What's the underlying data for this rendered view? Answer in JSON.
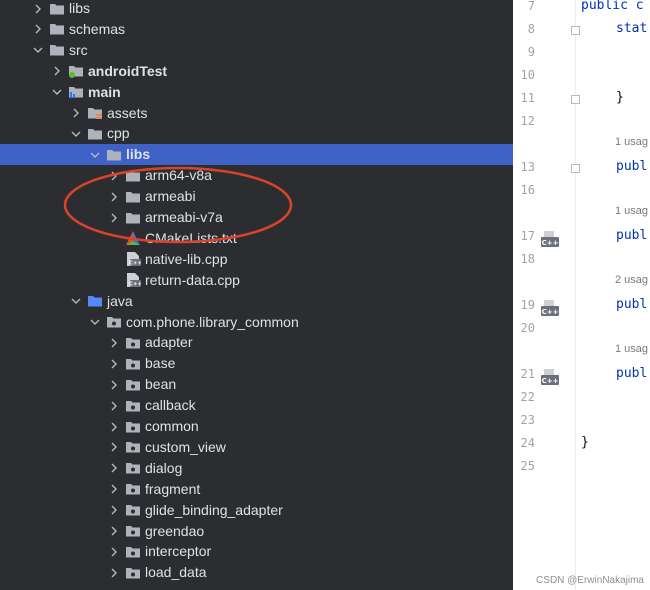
{
  "tree": {
    "rows": [
      {
        "label": "libs",
        "indent": 0,
        "chevron": "right",
        "icon": "folder"
      },
      {
        "label": "schemas",
        "indent": 0,
        "chevron": "right",
        "icon": "folder"
      },
      {
        "label": "src",
        "indent": 0,
        "chevron": "down",
        "icon": "folder"
      },
      {
        "label": "androidTest",
        "indent": 1,
        "chevron": "right",
        "icon": "folder-test",
        "bold": true
      },
      {
        "label": "main",
        "indent": 1,
        "chevron": "down",
        "icon": "folder-module",
        "bold": true
      },
      {
        "label": "assets",
        "indent": 2,
        "chevron": "right",
        "icon": "folder-resources"
      },
      {
        "label": "cpp",
        "indent": 2,
        "chevron": "down",
        "icon": "folder"
      },
      {
        "label": "libs",
        "indent": 3,
        "chevron": "down",
        "icon": "folder",
        "selected": true,
        "bold": true
      },
      {
        "label": "arm64-v8a",
        "indent": 4,
        "chevron": "right",
        "icon": "folder"
      },
      {
        "label": "armeabi",
        "indent": 4,
        "chevron": "right",
        "icon": "folder"
      },
      {
        "label": "armeabi-v7a",
        "indent": 4,
        "chevron": "right",
        "icon": "folder"
      },
      {
        "label": "CMakeLists.txt",
        "indent": 4,
        "chevron": "none",
        "icon": "cmake-file"
      },
      {
        "label": "native-lib.cpp",
        "indent": 4,
        "chevron": "none",
        "icon": "cpp-file"
      },
      {
        "label": "return-data.cpp",
        "indent": 4,
        "chevron": "none",
        "icon": "cpp-file"
      },
      {
        "label": "java",
        "indent": 2,
        "chevron": "down",
        "icon": "folder-source"
      },
      {
        "label": "com.phone.library_common",
        "indent": 3,
        "chevron": "down",
        "icon": "package"
      },
      {
        "label": "adapter",
        "indent": 4,
        "chevron": "right",
        "icon": "package"
      },
      {
        "label": "base",
        "indent": 4,
        "chevron": "right",
        "icon": "package"
      },
      {
        "label": "bean",
        "indent": 4,
        "chevron": "right",
        "icon": "package"
      },
      {
        "label": "callback",
        "indent": 4,
        "chevron": "right",
        "icon": "package"
      },
      {
        "label": "common",
        "indent": 4,
        "chevron": "right",
        "icon": "package"
      },
      {
        "label": "custom_view",
        "indent": 4,
        "chevron": "right",
        "icon": "package"
      },
      {
        "label": "dialog",
        "indent": 4,
        "chevron": "right",
        "icon": "package"
      },
      {
        "label": "fragment",
        "indent": 4,
        "chevron": "right",
        "icon": "package"
      },
      {
        "label": "glide_binding_adapter",
        "indent": 4,
        "chevron": "right",
        "icon": "package"
      },
      {
        "label": "greendao",
        "indent": 4,
        "chevron": "right",
        "icon": "package"
      },
      {
        "label": "interceptor",
        "indent": 4,
        "chevron": "right",
        "icon": "package"
      },
      {
        "label": "load_data",
        "indent": 4,
        "chevron": "right",
        "icon": "package"
      }
    ]
  },
  "editor": {
    "lines": [
      {
        "n": "7",
        "code": "public c",
        "fold": false,
        "cpp": false
      },
      {
        "n": "8",
        "code": "stat",
        "fold": true,
        "cpp": false,
        "indent": 1
      },
      {
        "n": "9",
        "code": "",
        "fold": false,
        "cpp": false
      },
      {
        "n": "10",
        "code": "",
        "fold": false,
        "cpp": false
      },
      {
        "n": "11",
        "code": "}",
        "fold": true,
        "cpp": false,
        "indent": 1,
        "plain": true
      },
      {
        "n": "12",
        "code": "",
        "fold": false,
        "cpp": false
      },
      {
        "hint": "1 usag"
      },
      {
        "n": "13",
        "code": "publ",
        "fold": true,
        "cpp": false,
        "indent": 1
      },
      {
        "n": "16",
        "code": "",
        "fold": false,
        "cpp": false
      },
      {
        "hint": "1 usag"
      },
      {
        "n": "17",
        "code": "publ",
        "fold": false,
        "cpp": true,
        "indent": 1
      },
      {
        "n": "18",
        "code": "",
        "fold": false,
        "cpp": false
      },
      {
        "hint": "2 usag"
      },
      {
        "n": "19",
        "code": "publ",
        "fold": false,
        "cpp": true,
        "indent": 1
      },
      {
        "n": "20",
        "code": "",
        "fold": false,
        "cpp": false
      },
      {
        "hint": "1 usag"
      },
      {
        "n": "21",
        "code": "publ",
        "fold": false,
        "cpp": true,
        "indent": 1
      },
      {
        "n": "22",
        "code": "",
        "fold": false,
        "cpp": false
      },
      {
        "n": "23",
        "code": "",
        "fold": false,
        "cpp": false
      },
      {
        "n": "24",
        "code": "}",
        "fold": false,
        "cpp": false,
        "plain": true
      },
      {
        "n": "25",
        "code": "",
        "fold": false,
        "cpp": false
      }
    ]
  },
  "watermark": "CSDN @ErwinNakajima",
  "colors": {
    "selection": "#3f62c7",
    "annotation": "#d9432b",
    "keyword": "#0033b3"
  }
}
